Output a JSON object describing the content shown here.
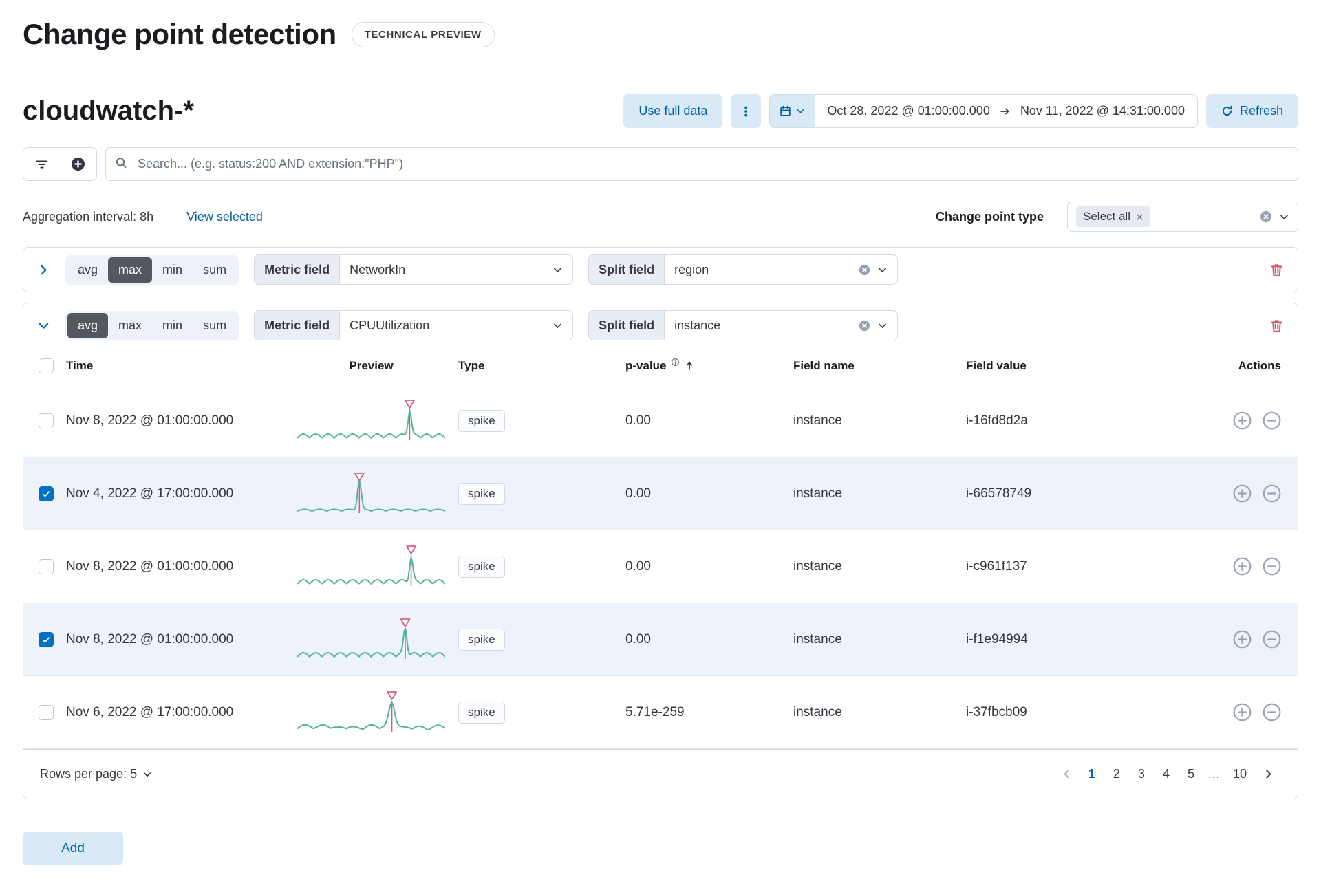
{
  "colors": {
    "primary": "#0061a6",
    "primary_light_bg": "#d9e9f6",
    "accent_pink": "#d36086",
    "chart_line_green": "#54b399",
    "danger_trash": "#d2546f",
    "selected_row_bg": "#eef3f9",
    "border": "#d3dae6",
    "checkbox_checked": "#0071c2"
  },
  "header": {
    "title": "Change point detection",
    "badge": "TECHNICAL PREVIEW"
  },
  "toolbar": {
    "index_pattern": "cloudwatch-*",
    "use_full_data_label": "Use full data",
    "date_start": "Oct 28, 2022 @ 01:00:00.000",
    "date_end": "Nov 11, 2022 @ 14:31:00.000",
    "refresh_label": "Refresh"
  },
  "search": {
    "placeholder": "Search... (e.g. status:200 AND extension:\"PHP\")"
  },
  "meta": {
    "aggregation_interval_label": "Aggregation interval: 8h",
    "view_selected_label": "View selected",
    "change_point_type_label": "Change point type",
    "select_all_token": "Select all"
  },
  "agg_options": {
    "avg": "avg",
    "max": "max",
    "min": "min",
    "sum": "sum"
  },
  "configs": [
    {
      "selected_agg": "max",
      "metric_label": "Metric field",
      "metric_value": "NetworkIn",
      "split_label": "Split field",
      "split_value": "region"
    },
    {
      "selected_agg": "avg",
      "metric_label": "Metric field",
      "metric_value": "CPUUtilization",
      "split_label": "Split field",
      "split_value": "instance"
    }
  ],
  "table": {
    "columns": {
      "time": "Time",
      "preview": "Preview",
      "type": "Type",
      "p_value": "p-value",
      "field_name": "Field name",
      "field_value": "Field value",
      "actions": "Actions"
    },
    "rows": [
      {
        "time": "Nov 8, 2022 @ 01:00:00.000",
        "type": "spike",
        "p_value": "0.00",
        "field_name": "instance",
        "field_value": "i-16fd8d2a",
        "checked": false,
        "spark": {
          "spike_x": 0.76,
          "spike_h": 36,
          "waves": 12,
          "amp": 6,
          "sigma": 0.012
        }
      },
      {
        "time": "Nov 4, 2022 @ 17:00:00.000",
        "type": "spike",
        "p_value": "0.00",
        "field_name": "instance",
        "field_value": "i-66578749",
        "checked": true,
        "spark": {
          "spike_x": 0.42,
          "spike_h": 42,
          "waves": 10,
          "amp": 2.5,
          "sigma": 0.013
        }
      },
      {
        "time": "Nov 8, 2022 @ 01:00:00.000",
        "type": "spike",
        "p_value": "0.00",
        "field_name": "instance",
        "field_value": "i-c961f137",
        "checked": false,
        "spark": {
          "spike_x": 0.77,
          "spike_h": 33,
          "waves": 12,
          "amp": 6,
          "sigma": 0.012
        }
      },
      {
        "time": "Nov 8, 2022 @ 01:00:00.000",
        "type": "spike",
        "p_value": "0.00",
        "field_name": "instance",
        "field_value": "i-f1e94994",
        "checked": true,
        "spark": {
          "spike_x": 0.73,
          "spike_h": 37,
          "waves": 12,
          "amp": 6,
          "sigma": 0.012
        }
      },
      {
        "time": "Nov 6, 2022 @ 17:00:00.000",
        "type": "spike",
        "p_value": "5.71e-259",
        "field_name": "instance",
        "field_value": "i-37fbcb09",
        "checked": false,
        "spark": {
          "spike_x": 0.64,
          "spike_h": 33,
          "waves": 9,
          "amp": 4,
          "sigma": 0.02,
          "jitter": 1.6
        }
      }
    ]
  },
  "footer": {
    "rows_per_page_label": "Rows per page: 5",
    "pages": [
      "1",
      "2",
      "3",
      "4",
      "5",
      "…",
      "10"
    ],
    "active_page": "1"
  },
  "add_label": "Add"
}
